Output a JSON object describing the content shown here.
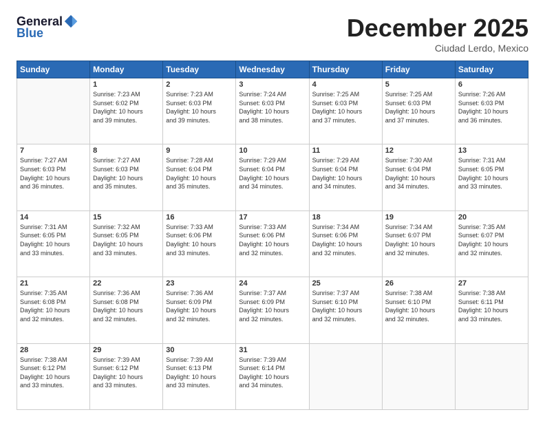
{
  "header": {
    "logo_line1": "General",
    "logo_line2": "Blue",
    "month": "December 2025",
    "location": "Ciudad Lerdo, Mexico"
  },
  "weekdays": [
    "Sunday",
    "Monday",
    "Tuesday",
    "Wednesday",
    "Thursday",
    "Friday",
    "Saturday"
  ],
  "weeks": [
    [
      {
        "day": "",
        "info": ""
      },
      {
        "day": "1",
        "info": "Sunrise: 7:23 AM\nSunset: 6:02 PM\nDaylight: 10 hours\nand 39 minutes."
      },
      {
        "day": "2",
        "info": "Sunrise: 7:23 AM\nSunset: 6:03 PM\nDaylight: 10 hours\nand 39 minutes."
      },
      {
        "day": "3",
        "info": "Sunrise: 7:24 AM\nSunset: 6:03 PM\nDaylight: 10 hours\nand 38 minutes."
      },
      {
        "day": "4",
        "info": "Sunrise: 7:25 AM\nSunset: 6:03 PM\nDaylight: 10 hours\nand 37 minutes."
      },
      {
        "day": "5",
        "info": "Sunrise: 7:25 AM\nSunset: 6:03 PM\nDaylight: 10 hours\nand 37 minutes."
      },
      {
        "day": "6",
        "info": "Sunrise: 7:26 AM\nSunset: 6:03 PM\nDaylight: 10 hours\nand 36 minutes."
      }
    ],
    [
      {
        "day": "7",
        "info": "Sunrise: 7:27 AM\nSunset: 6:03 PM\nDaylight: 10 hours\nand 36 minutes."
      },
      {
        "day": "8",
        "info": "Sunrise: 7:27 AM\nSunset: 6:03 PM\nDaylight: 10 hours\nand 35 minutes."
      },
      {
        "day": "9",
        "info": "Sunrise: 7:28 AM\nSunset: 6:04 PM\nDaylight: 10 hours\nand 35 minutes."
      },
      {
        "day": "10",
        "info": "Sunrise: 7:29 AM\nSunset: 6:04 PM\nDaylight: 10 hours\nand 34 minutes."
      },
      {
        "day": "11",
        "info": "Sunrise: 7:29 AM\nSunset: 6:04 PM\nDaylight: 10 hours\nand 34 minutes."
      },
      {
        "day": "12",
        "info": "Sunrise: 7:30 AM\nSunset: 6:04 PM\nDaylight: 10 hours\nand 34 minutes."
      },
      {
        "day": "13",
        "info": "Sunrise: 7:31 AM\nSunset: 6:05 PM\nDaylight: 10 hours\nand 33 minutes."
      }
    ],
    [
      {
        "day": "14",
        "info": "Sunrise: 7:31 AM\nSunset: 6:05 PM\nDaylight: 10 hours\nand 33 minutes."
      },
      {
        "day": "15",
        "info": "Sunrise: 7:32 AM\nSunset: 6:05 PM\nDaylight: 10 hours\nand 33 minutes."
      },
      {
        "day": "16",
        "info": "Sunrise: 7:33 AM\nSunset: 6:06 PM\nDaylight: 10 hours\nand 33 minutes."
      },
      {
        "day": "17",
        "info": "Sunrise: 7:33 AM\nSunset: 6:06 PM\nDaylight: 10 hours\nand 32 minutes."
      },
      {
        "day": "18",
        "info": "Sunrise: 7:34 AM\nSunset: 6:06 PM\nDaylight: 10 hours\nand 32 minutes."
      },
      {
        "day": "19",
        "info": "Sunrise: 7:34 AM\nSunset: 6:07 PM\nDaylight: 10 hours\nand 32 minutes."
      },
      {
        "day": "20",
        "info": "Sunrise: 7:35 AM\nSunset: 6:07 PM\nDaylight: 10 hours\nand 32 minutes."
      }
    ],
    [
      {
        "day": "21",
        "info": "Sunrise: 7:35 AM\nSunset: 6:08 PM\nDaylight: 10 hours\nand 32 minutes."
      },
      {
        "day": "22",
        "info": "Sunrise: 7:36 AM\nSunset: 6:08 PM\nDaylight: 10 hours\nand 32 minutes."
      },
      {
        "day": "23",
        "info": "Sunrise: 7:36 AM\nSunset: 6:09 PM\nDaylight: 10 hours\nand 32 minutes."
      },
      {
        "day": "24",
        "info": "Sunrise: 7:37 AM\nSunset: 6:09 PM\nDaylight: 10 hours\nand 32 minutes."
      },
      {
        "day": "25",
        "info": "Sunrise: 7:37 AM\nSunset: 6:10 PM\nDaylight: 10 hours\nand 32 minutes."
      },
      {
        "day": "26",
        "info": "Sunrise: 7:38 AM\nSunset: 6:10 PM\nDaylight: 10 hours\nand 32 minutes."
      },
      {
        "day": "27",
        "info": "Sunrise: 7:38 AM\nSunset: 6:11 PM\nDaylight: 10 hours\nand 33 minutes."
      }
    ],
    [
      {
        "day": "28",
        "info": "Sunrise: 7:38 AM\nSunset: 6:12 PM\nDaylight: 10 hours\nand 33 minutes."
      },
      {
        "day": "29",
        "info": "Sunrise: 7:39 AM\nSunset: 6:12 PM\nDaylight: 10 hours\nand 33 minutes."
      },
      {
        "day": "30",
        "info": "Sunrise: 7:39 AM\nSunset: 6:13 PM\nDaylight: 10 hours\nand 33 minutes."
      },
      {
        "day": "31",
        "info": "Sunrise: 7:39 AM\nSunset: 6:14 PM\nDaylight: 10 hours\nand 34 minutes."
      },
      {
        "day": "",
        "info": ""
      },
      {
        "day": "",
        "info": ""
      },
      {
        "day": "",
        "info": ""
      }
    ]
  ]
}
